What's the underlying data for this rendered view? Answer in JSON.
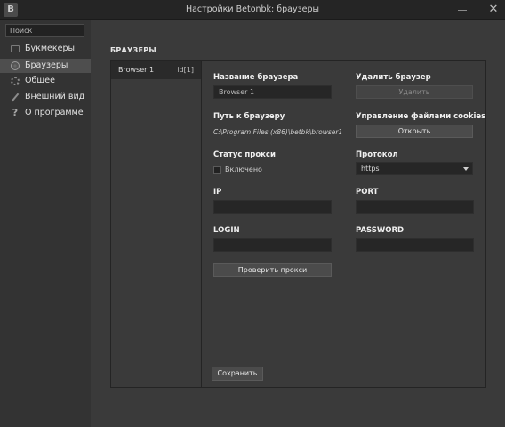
{
  "window": {
    "app_icon_letter": "B",
    "title": "Настройки Betonbk: браузеры",
    "close_glyph": "✕"
  },
  "sidebar": {
    "search_placeholder": "Поиск",
    "items": [
      {
        "label": "Букмекеры",
        "icon": "book-icon",
        "active": false
      },
      {
        "label": "Браузеры",
        "icon": "globe-icon",
        "active": true
      },
      {
        "label": "Общее",
        "icon": "gear-icon",
        "active": false
      },
      {
        "label": "Внешний вид",
        "icon": "brush-icon",
        "active": false
      },
      {
        "label": "О программе",
        "icon": "help-icon",
        "active": false
      }
    ],
    "help_glyph": "?"
  },
  "section": {
    "title": "БРАУЗЕРЫ"
  },
  "browsers": [
    {
      "name": "Browser 1",
      "id": "id[1]",
      "selected": true
    }
  ],
  "form": {
    "name_label": "Название браузера",
    "name_value": "Browser 1",
    "delete_label": "Удалить браузер",
    "delete_button": "Удалить",
    "path_label": "Путь к браузеру",
    "path_value": "C:\\Program Files (x86)\\betbk\\browser1",
    "cookies_label": "Управление файлами cookies",
    "open_button": "Открыть",
    "proxy_status_label": "Статус прокси",
    "proxy_enabled_label": "Включено",
    "proxy_enabled": false,
    "protocol_label": "Протокол",
    "protocol_value": "https",
    "ip_label": "IP",
    "ip_value": "",
    "port_label": "PORT",
    "port_value": "",
    "login_label": "LOGIN",
    "login_value": "",
    "password_label": "PASSWORD",
    "password_value": "",
    "check_proxy_button": "Проверить прокси",
    "save_button": "Сохранить"
  },
  "colors": {
    "titlebar": "#252525",
    "sidebar": "#333333",
    "sidebar_active": "#4e4e4e",
    "content": "#3a3a3a",
    "input": "#262626",
    "button": "#4b4b4b"
  }
}
